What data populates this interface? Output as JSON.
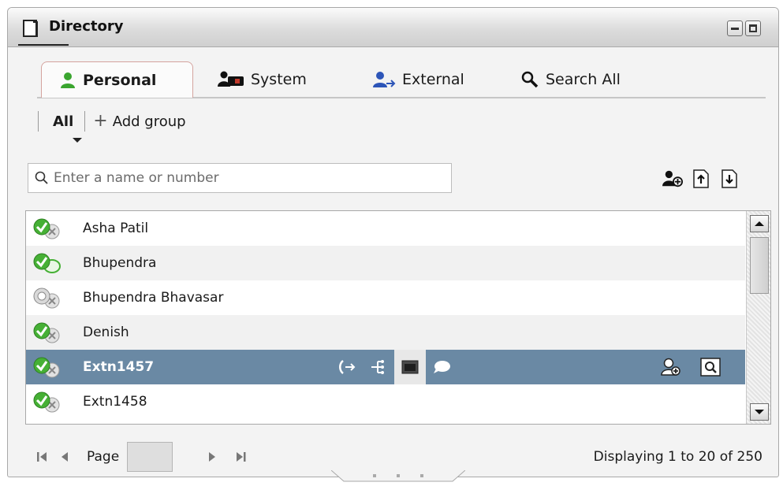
{
  "window": {
    "title": "Directory",
    "title_icon": "document-icon",
    "controls": [
      "minimize-icon",
      "maximize-icon"
    ]
  },
  "tabs": [
    {
      "label": "Personal",
      "icon": "person-green-icon",
      "active": true
    },
    {
      "label": "System",
      "icon": "people-system-icon",
      "active": false
    },
    {
      "label": "External",
      "icon": "person-blue-icon",
      "active": false
    },
    {
      "label": "Search All",
      "icon": "magnifier-icon",
      "active": false
    }
  ],
  "groups": {
    "all_label": "All",
    "add_label": "Add group"
  },
  "search": {
    "placeholder": "Enter a name or number",
    "value": ""
  },
  "toolbar_icons": [
    "add-contact-icon",
    "upload-icon",
    "download-icon"
  ],
  "contacts": [
    {
      "name": "Asha Patil",
      "status": "available-idle"
    },
    {
      "name": "Bhupendra",
      "status": "available-chat"
    },
    {
      "name": "Bhupendra Bhavasar",
      "status": "offline"
    },
    {
      "name": "Denish",
      "status": "available-idle"
    },
    {
      "name": "Extn1457",
      "status": "available-idle",
      "selected": true
    },
    {
      "name": "Extn1458",
      "status": "available-idle"
    }
  ],
  "selected_row_actions": [
    "call-icon",
    "transfer-icon",
    "video-window-icon",
    "chat-bubble-icon"
  ],
  "selected_row_right_actions": [
    "add-to-personal-icon",
    "view-details-icon"
  ],
  "pager": {
    "page_label": "Page",
    "page_value": "",
    "displaying": "Displaying 1 to 20 of 250"
  },
  "colors": {
    "selected_row": "#6a89a4",
    "presence_green": "#3aa52f",
    "tab_active_border": "#d4a39e"
  }
}
